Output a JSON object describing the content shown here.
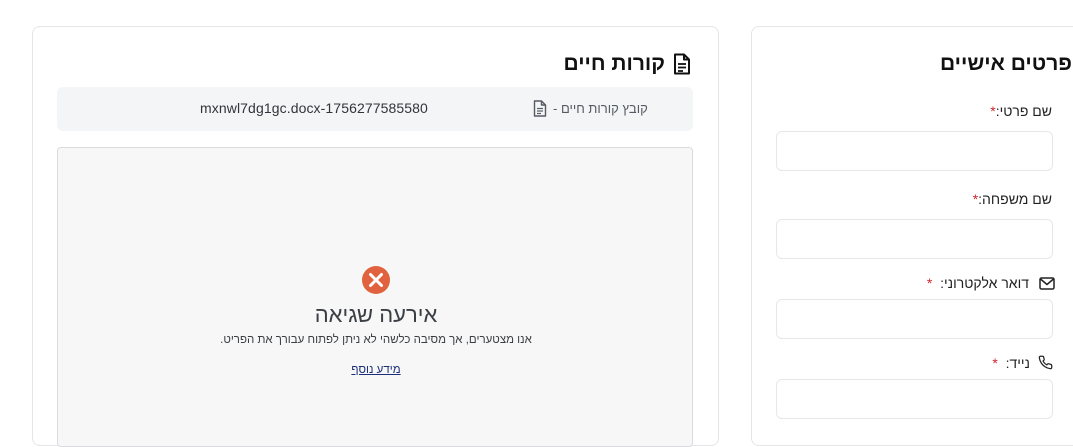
{
  "resume_card": {
    "title": "קורות חיים",
    "title_icon": "document-icon",
    "file_bar": {
      "icon": "document-icon",
      "label": "קובץ קורות חיים -",
      "file_name": "mxnwl7dg1gc.docx-1756277585580"
    },
    "preview": {
      "error_icon": "error-circle-x-icon",
      "error_color": "#e0623f",
      "error_title": "אירעה שגיאה",
      "error_message": ".אנו מצטערים, אך מסיבה כלשהי לא ניתן לפתוח עבורך את הפריט",
      "more_info_link": "מידע נוסף"
    }
  },
  "personal_card": {
    "title": "פרטים אישיים",
    "fields": [
      {
        "label": "שם פרטי:",
        "required_mark": "*",
        "value": "",
        "placeholder": ""
      },
      {
        "label": "שם משפחה:",
        "required_mark": "*",
        "value": "",
        "placeholder": ""
      },
      {
        "label": "דואר אלקטרוני:",
        "required_mark": "*",
        "icon": "mail-icon",
        "value": "",
        "placeholder": ""
      },
      {
        "label": "נייד:",
        "required_mark": "*",
        "icon": "phone-icon",
        "value": "",
        "placeholder": ""
      }
    ]
  },
  "colors": {
    "required": "#d0242b",
    "link": "#1d2f7a",
    "card_border": "#e3e5e8"
  }
}
